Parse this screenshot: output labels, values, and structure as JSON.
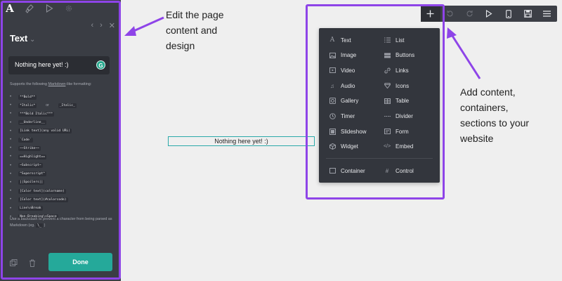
{
  "editor": {
    "title": "Text",
    "title_chevron": "⌄",
    "input_value": "Nothing here yet! :)",
    "grammar_badge": "G",
    "supports_prefix": "Supports the following ",
    "supports_link": "Markdown",
    "supports_suffix": "-like formatting:",
    "formats": [
      "**Bold**",
      "*Italic*",
      "_Italic_",
      "***Bold Italic***",
      "__Underline__",
      "[Link text](any valid URL)",
      "`Code`",
      "~~Strike~~",
      "==Highlight==",
      "~Subscript~",
      "^Superscript^",
      "||Spoilers||",
      "[Color text](colorname)",
      "[Color text](#colorcode)",
      "Line\\nBreak",
      "Non-Breaking\\sSpace"
    ],
    "or_text": "or",
    "escape_prefix": "Use a backslash to prevent a character from being parsed as Markdown (eg. ",
    "escape_code": "\\_",
    "escape_suffix": " )",
    "done_label": "Done",
    "tab_icons": [
      "text-tab-icon",
      "brush-tab-icon",
      "play-tab-icon",
      "gear-tab-icon"
    ]
  },
  "canvas": {
    "text": "Nothing here yet! :)"
  },
  "annotations": {
    "left_text": [
      "Edit the page",
      "content and",
      "design"
    ],
    "right_text": [
      "Add content,",
      "containers,",
      "sections to your",
      "website"
    ]
  },
  "toolbar": {
    "buttons": [
      "add",
      "undo",
      "redo",
      "preview",
      "mobile",
      "save",
      "menu"
    ]
  },
  "add_menu": {
    "left_items": [
      {
        "label": "Text",
        "icon": "text-icon"
      },
      {
        "label": "Image",
        "icon": "image-icon"
      },
      {
        "label": "Video",
        "icon": "video-icon"
      },
      {
        "label": "Audio",
        "icon": "audio-icon"
      },
      {
        "label": "Gallery",
        "icon": "gallery-icon"
      },
      {
        "label": "Timer",
        "icon": "timer-icon"
      },
      {
        "label": "Slideshow",
        "icon": "slideshow-icon"
      },
      {
        "label": "Widget",
        "icon": "widget-icon"
      }
    ],
    "right_items": [
      {
        "label": "List",
        "icon": "list-icon"
      },
      {
        "label": "Buttons",
        "icon": "buttons-icon"
      },
      {
        "label": "Links",
        "icon": "links-icon"
      },
      {
        "label": "Icons",
        "icon": "icons-icon"
      },
      {
        "label": "Table",
        "icon": "table-icon"
      },
      {
        "label": "Divider",
        "icon": "divider-icon"
      },
      {
        "label": "Form",
        "icon": "form-icon"
      },
      {
        "label": "Embed",
        "icon": "embed-icon"
      }
    ],
    "container_label": "Container",
    "control_label": "Control"
  },
  "colors": {
    "panel_bg": "#3a3d44",
    "accent": "#25a99a",
    "highlight_outline": "#8e44e8",
    "canvas_bg": "#efefef"
  }
}
